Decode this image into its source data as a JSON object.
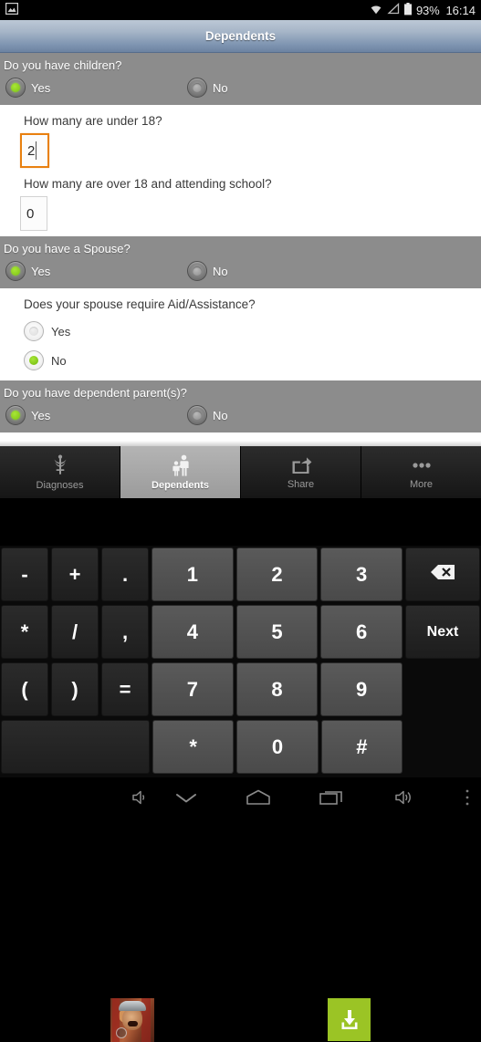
{
  "statusbar": {
    "left_icon": "image-icon",
    "wifi_icon": "wifi-icon",
    "signal_icon": "signal-icon",
    "battery_icon": "battery-icon",
    "battery_percent": "93%",
    "clock": "16:14"
  },
  "titlebar": {
    "title": "Dependents"
  },
  "form": {
    "sections": [
      {
        "question": "Do you have children?",
        "yes_label": "Yes",
        "no_label": "No",
        "selected": "Yes"
      },
      {
        "question": "Do you have a Spouse?",
        "yes_label": "Yes",
        "no_label": "No",
        "selected": "Yes"
      },
      {
        "question": "Do you have dependent parent(s)?",
        "yes_label": "Yes",
        "no_label": "No",
        "selected": "Yes"
      }
    ],
    "children_sub": {
      "under18_label": "How many are under 18?",
      "under18_value": "2",
      "over18_label": "How many are over 18 and attending school?",
      "over18_value": "0"
    },
    "spouse_sub": {
      "question": "Does your spouse require Aid/Assistance?",
      "yes_label": "Yes",
      "no_label": "No",
      "selected": "No"
    },
    "focus_color": "#e8800f"
  },
  "tabbar": {
    "tabs": [
      {
        "label": "Diagnoses",
        "icon": "caduceus-icon",
        "active": false
      },
      {
        "label": "Dependents",
        "icon": "family-icon",
        "active": true
      },
      {
        "label": "Share",
        "icon": "share-icon",
        "active": false
      },
      {
        "label": "More",
        "icon": "more-dots-icon",
        "active": false
      }
    ]
  },
  "ad": {
    "thumbnail_icon": "game-app-icon",
    "download_icon": "download-icon",
    "download_color": "#9bc425"
  },
  "keyboard": {
    "rows": [
      {
        "keys": [
          {
            "label": "-",
            "type": "sym"
          },
          {
            "label": "+",
            "type": "sym"
          },
          {
            "label": ".",
            "type": "sym"
          },
          {
            "label": "1",
            "type": "num"
          },
          {
            "label": "2",
            "type": "num"
          },
          {
            "label": "3",
            "type": "num"
          },
          {
            "label": "",
            "type": "backspace",
            "icon": "backspace-icon"
          }
        ]
      },
      {
        "keys": [
          {
            "label": "*",
            "type": "sym"
          },
          {
            "label": "/",
            "type": "sym"
          },
          {
            "label": ",",
            "type": "sym"
          },
          {
            "label": "4",
            "type": "num"
          },
          {
            "label": "5",
            "type": "num"
          },
          {
            "label": "6",
            "type": "num"
          },
          {
            "label": "Next",
            "type": "func"
          }
        ]
      },
      {
        "keys": [
          {
            "label": "(",
            "type": "sym"
          },
          {
            "label": ")",
            "type": "sym"
          },
          {
            "label": "=",
            "type": "sym"
          },
          {
            "label": "7",
            "type": "num"
          },
          {
            "label": "8",
            "type": "num"
          },
          {
            "label": "9",
            "type": "num"
          },
          {
            "label": "",
            "type": "spacer"
          }
        ]
      },
      {
        "keys": [
          {
            "label": "",
            "type": "blank"
          },
          {
            "label": "*",
            "type": "num"
          },
          {
            "label": "0",
            "type": "num"
          },
          {
            "label": "#",
            "type": "num"
          },
          {
            "label": "",
            "type": "spacer"
          }
        ]
      }
    ]
  },
  "navbar": {
    "buttons": [
      {
        "icon": "volume-down-icon"
      },
      {
        "icon": "hide-keyboard-icon"
      },
      {
        "icon": "home-icon"
      },
      {
        "icon": "recents-icon"
      },
      {
        "icon": "volume-up-icon"
      },
      {
        "icon": "menu-dots-icon"
      }
    ]
  }
}
